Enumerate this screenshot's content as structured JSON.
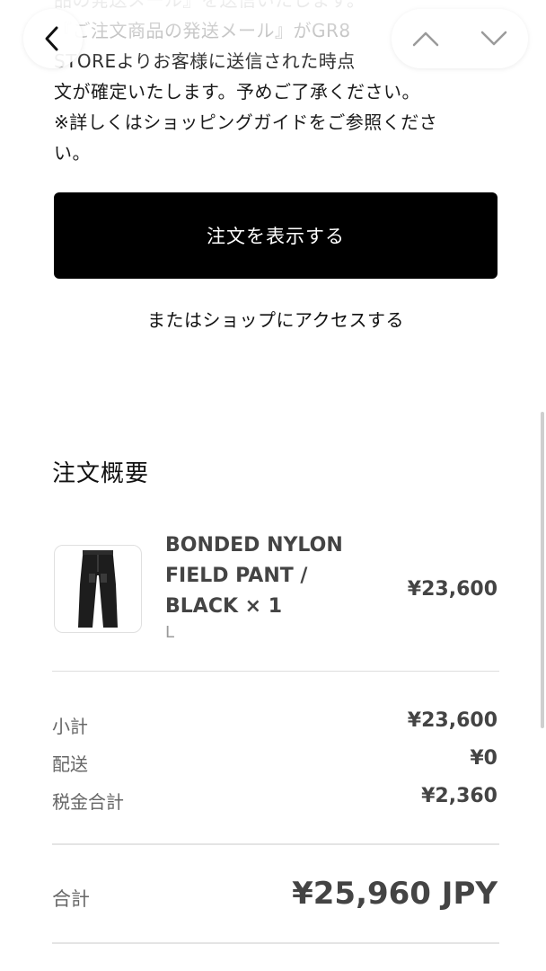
{
  "top_text": {
    "line1": "品の発送メール』を送信いたします。",
    "line2": "『ご注文商品の発送メール』がGR8",
    "line3": "STOREよりお客様に送信された時点",
    "line4": "文が確定いたします。予めご了承ください。",
    "line5": "※詳しくはショッピングガイドをご参照くださ",
    "line6": "い。"
  },
  "nav": {
    "back_icon": "chevron-left-icon",
    "up_icon": "chevron-up-icon",
    "down_icon": "chevron-down-icon"
  },
  "actions": {
    "view_order_label": "注文を表示する",
    "shop_link_label": "またはショップにアクセスする"
  },
  "summary": {
    "title": "注文概要",
    "item": {
      "name_line1": "BONDED NYLON",
      "name_line2": "FIELD PANT /",
      "name_line3": "BLACK × 1",
      "variant": "L",
      "price": "¥23,600"
    },
    "rows": [
      {
        "label": "小計",
        "value": "¥23,600"
      },
      {
        "label": "配送",
        "value": "¥0"
      },
      {
        "label": "税金合計",
        "value": "¥2,360"
      }
    ],
    "total_label": "合計",
    "total_value": "¥25,960 JPY"
  },
  "colors": {
    "button_bg": "#000000",
    "text_primary": "#111111",
    "text_muted": "#666666",
    "divider": "#dedede"
  }
}
